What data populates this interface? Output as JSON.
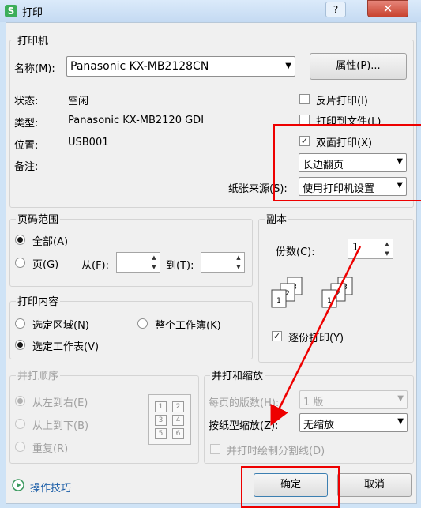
{
  "window": {
    "title": "打印",
    "app_icon": "S",
    "help": "?",
    "close": "✕"
  },
  "printer": {
    "group_title": "打印机",
    "name_label": "名称(M):",
    "name_value": "Panasonic KX-MB2128CN",
    "props_button": "属性(P)...",
    "status_label": "状态:",
    "status_value": "空闲",
    "type_label": "类型:",
    "type_value": "Panasonic KX-MB2120 GDI",
    "location_label": "位置:",
    "location_value": "USB001",
    "comment_label": "备注:",
    "reverse_print": "反片打印(I)",
    "print_to_file": "打印到文件(L)",
    "duplex": "双面打印(X)",
    "duplex_mode": "长边翻页",
    "paper_source_label": "纸张来源(S):",
    "paper_source_value": "使用打印机设置"
  },
  "page_range": {
    "group_title": "页码范围",
    "all": "全部(A)",
    "pages": "页(G)",
    "from_label": "从(F):",
    "to_label": "到(T):"
  },
  "copies": {
    "group_title": "副本",
    "count_label": "份数(C):",
    "count_value": "1",
    "collate": "逐份打印(Y)"
  },
  "print_content": {
    "group_title": "打印内容",
    "selection": "选定区域(N)",
    "whole_workbook": "整个工作簿(K)",
    "selected_sheet": "选定工作表(V)"
  },
  "order": {
    "group_title": "并打顺序",
    "left_to_right": "从左到右(E)",
    "top_to_bottom": "从上到下(B)",
    "repeat": "重复(R)",
    "grid": [
      "1",
      "2",
      "3",
      "4",
      "5",
      "6"
    ]
  },
  "scale": {
    "group_title": "并打和缩放",
    "pages_per_sheet_label": "每页的版数(H):",
    "pages_per_sheet_value": "1 版",
    "scale_label": "按纸型缩放(Z):",
    "scale_value": "无缩放",
    "draw_lines": "并打时绘制分割线(D)"
  },
  "footer": {
    "tips": "操作技巧",
    "ok": "确定",
    "cancel": "取消"
  },
  "colors": {
    "accent_red": "#e00000",
    "window_blue": "#cfe3f6"
  }
}
